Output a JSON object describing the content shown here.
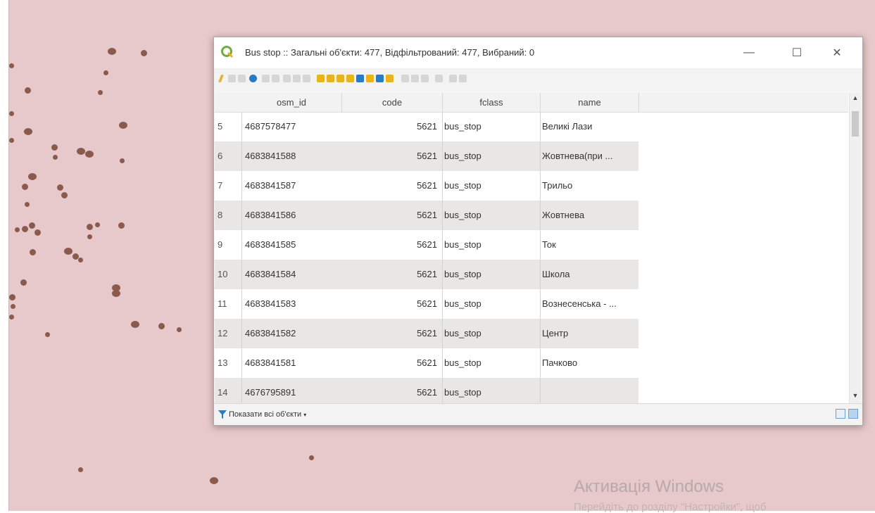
{
  "window": {
    "title": "Bus stop :: Загальні об'єкти: 477, Відфільтрований: 477, Вибраний: 0",
    "controls": {
      "minimize": "—",
      "maximize": "☐",
      "close": "✕"
    }
  },
  "table": {
    "headers": [
      "osm_id",
      "code",
      "fclass",
      "name"
    ],
    "rows": [
      {
        "num": "5",
        "osm_id": "4687578477",
        "code": "5621",
        "fclass": "bus_stop",
        "name": "Великі Лази"
      },
      {
        "num": "6",
        "osm_id": "4683841588",
        "code": "5621",
        "fclass": "bus_stop",
        "name": "Жовтнева(при ..."
      },
      {
        "num": "7",
        "osm_id": "4683841587",
        "code": "5621",
        "fclass": "bus_stop",
        "name": "Трильо"
      },
      {
        "num": "8",
        "osm_id": "4683841586",
        "code": "5621",
        "fclass": "bus_stop",
        "name": "Жовтнева"
      },
      {
        "num": "9",
        "osm_id": "4683841585",
        "code": "5621",
        "fclass": "bus_stop",
        "name": "Ток"
      },
      {
        "num": "10",
        "osm_id": "4683841584",
        "code": "5621",
        "fclass": "bus_stop",
        "name": "Школа"
      },
      {
        "num": "11",
        "osm_id": "4683841583",
        "code": "5621",
        "fclass": "bus_stop",
        "name": "Вознесенська - ..."
      },
      {
        "num": "12",
        "osm_id": "4683841582",
        "code": "5621",
        "fclass": "bus_stop",
        "name": "Центр"
      },
      {
        "num": "13",
        "osm_id": "4683841581",
        "code": "5621",
        "fclass": "bus_stop",
        "name": "Пачково"
      },
      {
        "num": "14",
        "osm_id": "4676795891",
        "code": "5621",
        "fclass": "bus_stop",
        "name": ""
      }
    ]
  },
  "bottom": {
    "filter_label": "Показати всі об'єкти"
  },
  "watermark": {
    "title": "Активація Windows",
    "subtitle": "Перейдіть до розділу \"Настройки\", щоб"
  },
  "colors": {
    "map_bg": "#e8c9cb",
    "point": "#8a5a4c",
    "qgis_green": "#6fae3c"
  }
}
